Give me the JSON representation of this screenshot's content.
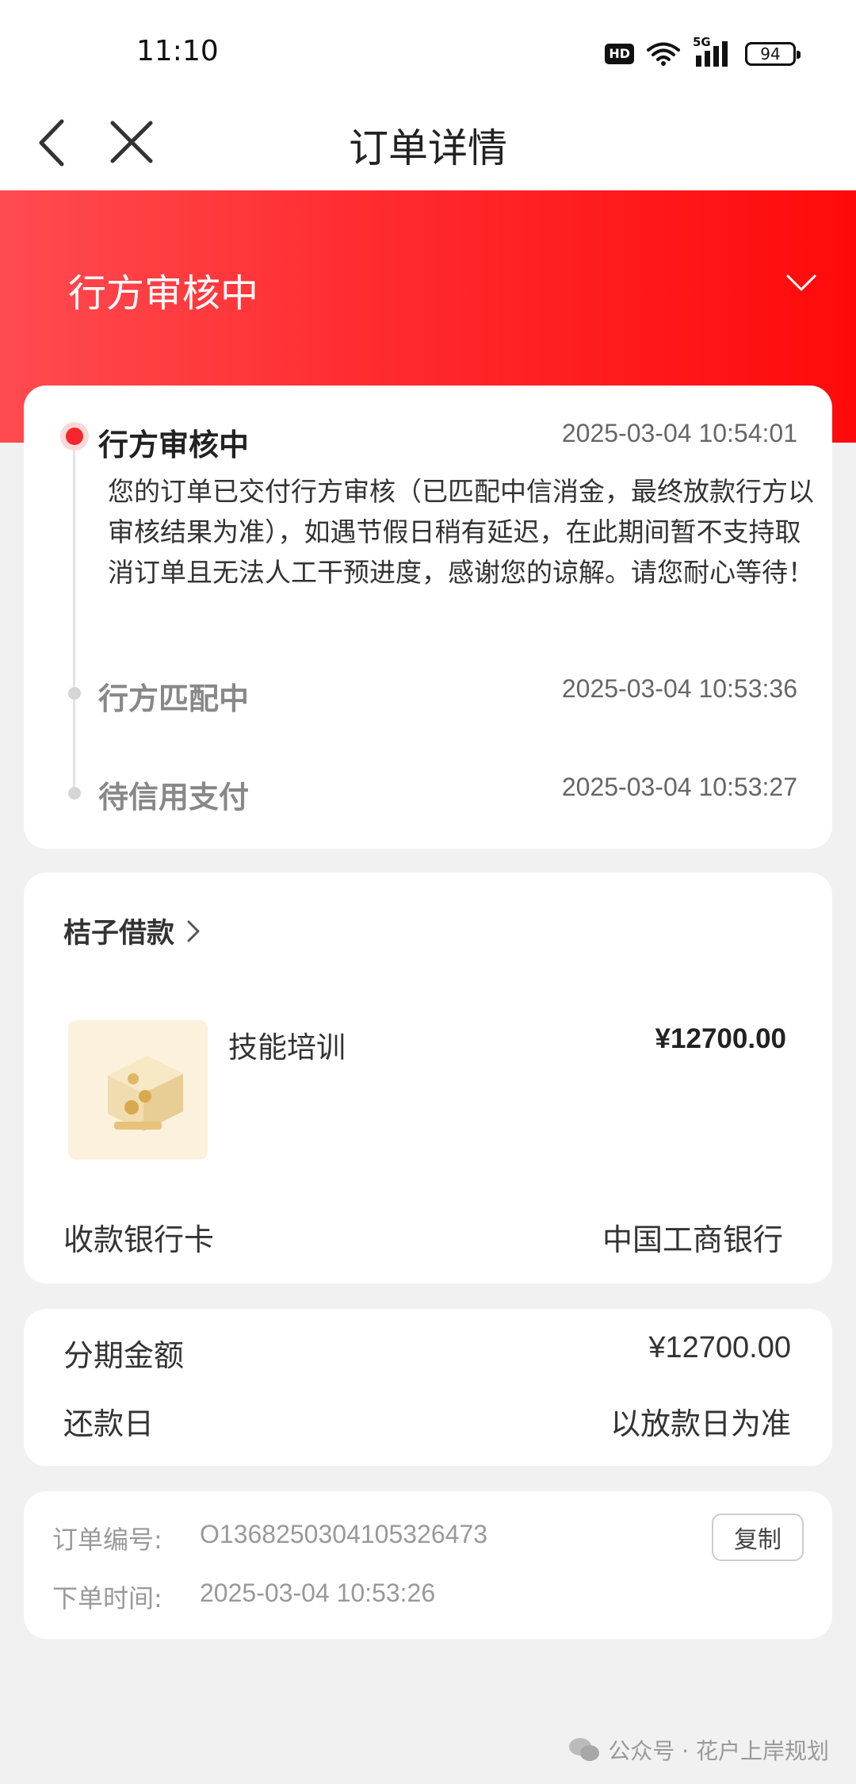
{
  "status_bar": {
    "time": "11:10",
    "hd": "HD",
    "network": "5G",
    "battery": "94"
  },
  "nav": {
    "title": "订单详情"
  },
  "header": {
    "status": "行方审核中"
  },
  "timeline": {
    "steps": [
      {
        "title": "行方审核中",
        "time": "2025-03-04 10:54:01",
        "desc": "您的订单已交付行方审核（已匹配中信消金，最终放款行方以审核结果为准），如遇节假日稍有延迟，在此期间暂不支持取消订单且无法人工干预进度，感谢您的谅解。请您耐心等待！"
      },
      {
        "title": "行方匹配中",
        "time": "2025-03-04 10:53:36"
      },
      {
        "title": "待信用支付",
        "time": "2025-03-04 10:53:27"
      }
    ]
  },
  "product_card": {
    "merchant": "桔子借款",
    "product_name": "技能培训",
    "price": "¥12700.00",
    "bank_label": "收款银行卡",
    "bank_value": "中国工商银行"
  },
  "installment": {
    "amount_label": "分期金额",
    "amount_value": "¥12700.00",
    "repay_label": "还款日",
    "repay_value": "以放款日为准"
  },
  "order_info": {
    "order_no_label": "订单编号:",
    "order_no": "O136825030410532647​3",
    "copy_label": "复制",
    "order_time_label": "下单时间:",
    "order_time": "2025-03-04 10:53:26"
  },
  "watermark": {
    "text": "公众号 · 花户上岸规划"
  },
  "colors": {
    "accent": "#ff1f24",
    "background": "#f1f1f1"
  }
}
